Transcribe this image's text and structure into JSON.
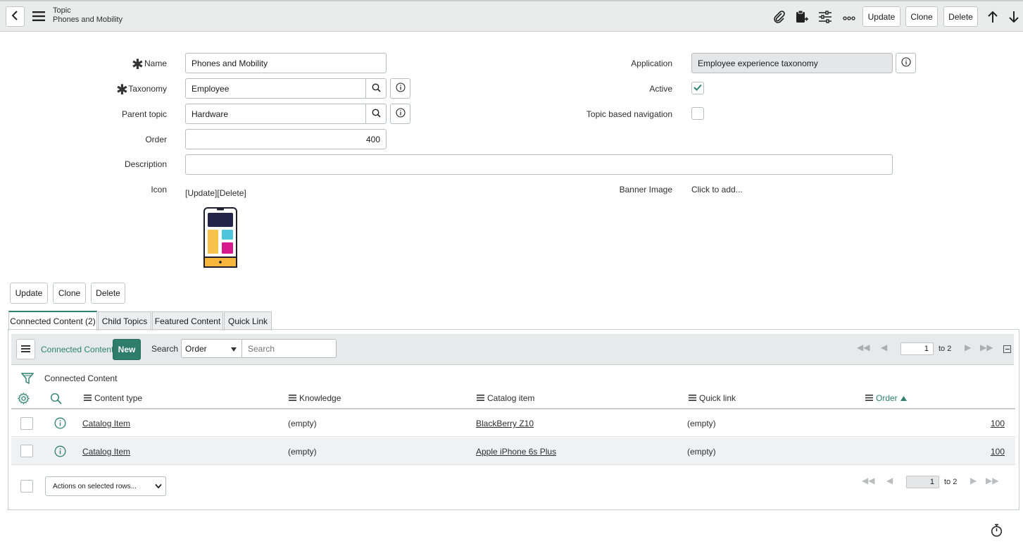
{
  "header": {
    "record_type": "Topic",
    "record_name": "Phones and Mobility",
    "buttons": {
      "update": "Update",
      "clone": "Clone",
      "delete": "Delete"
    },
    "icons": [
      "back-icon",
      "menu-icon",
      "paperclip-icon",
      "clipboard-icon",
      "sliders-icon",
      "more-icon",
      "arrow-up-icon",
      "arrow-down-icon"
    ]
  },
  "form": {
    "name": {
      "label": "Name",
      "value": "Phones and Mobility",
      "required": true
    },
    "taxonomy": {
      "label": "Taxonomy",
      "value": "Employee",
      "required": true
    },
    "parent_topic": {
      "label": "Parent topic",
      "value": "Hardware"
    },
    "order": {
      "label": "Order",
      "value": "400"
    },
    "description": {
      "label": "Description",
      "value": ""
    },
    "icon": {
      "label": "Icon",
      "actions": "[Update][Delete]"
    },
    "application": {
      "label": "Application",
      "value": "Employee experience taxonomy"
    },
    "active": {
      "label": "Active",
      "checked": true
    },
    "topic_based_navigation": {
      "label": "Topic based navigation",
      "checked": false
    },
    "banner_image": {
      "label": "Banner Image",
      "value": "Click to add..."
    }
  },
  "bottom_buttons": {
    "update": "Update",
    "clone": "Clone",
    "delete": "Delete"
  },
  "tabs": [
    {
      "label": "Connected Content (2)",
      "active": true
    },
    {
      "label": "Child Topics"
    },
    {
      "label": "Featured Content"
    },
    {
      "label": "Quick Link"
    }
  ],
  "list": {
    "title": "Connected Content",
    "new_label": "New",
    "search_label": "Search",
    "search_field": "Order",
    "search_placeholder": "Search",
    "page_current": "1",
    "page_total": "to 2",
    "breadcrumb": "Connected Content",
    "columns": [
      "Content type",
      "Knowledge",
      "Catalog item",
      "Quick link",
      "Order"
    ],
    "sort_column": "Order",
    "rows": [
      {
        "content_type": "Catalog Item",
        "knowledge": "(empty)",
        "catalog_item": "BlackBerry Z10",
        "quick_link": "(empty)",
        "order": "100"
      },
      {
        "content_type": "Catalog Item",
        "knowledge": "(empty)",
        "catalog_item": "Apple iPhone 6s Plus",
        "quick_link": "(empty)",
        "order": "100"
      }
    ],
    "actions_select": "Actions on selected rows..."
  },
  "colors": {
    "accent": "#2e8170",
    "header_bg": "#eaeceb"
  }
}
